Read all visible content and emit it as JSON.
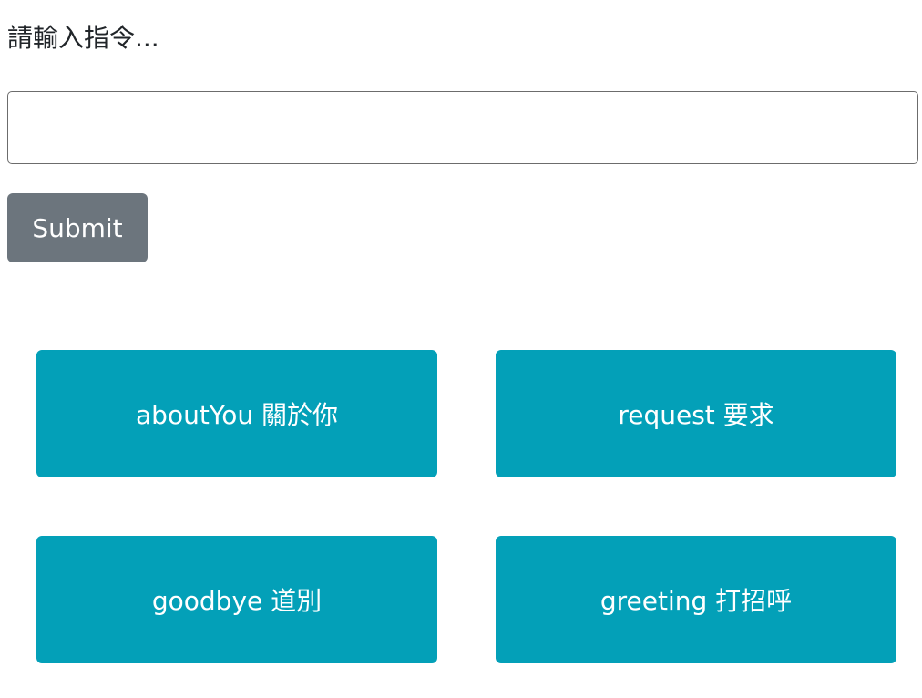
{
  "prompt": {
    "label": "請輸入指令...",
    "input_value": "",
    "input_placeholder": ""
  },
  "submit": {
    "label": "Submit"
  },
  "intents": [
    {
      "label": "aboutYou 關於你"
    },
    {
      "label": "request 要求"
    },
    {
      "label": "goodbye 道別"
    },
    {
      "label": "greeting 打招呼"
    }
  ],
  "colors": {
    "submit_bg": "#6c757d",
    "intent_bg": "#03a0b8",
    "text": "#212529"
  }
}
